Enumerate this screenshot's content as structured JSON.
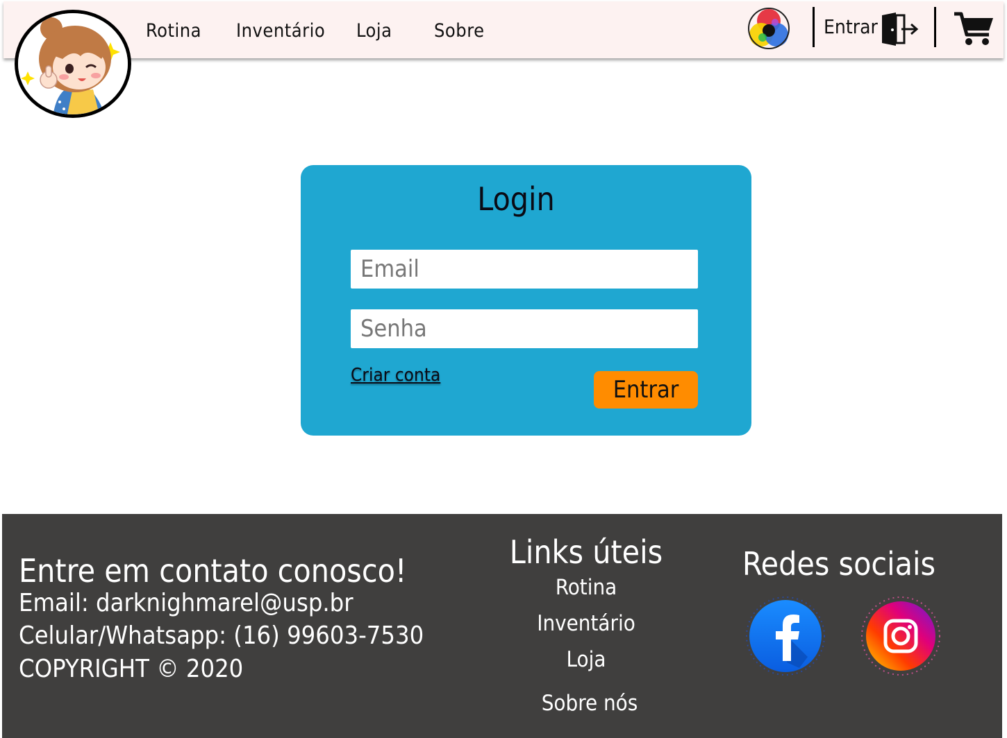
{
  "nav": {
    "links": [
      "Rotina",
      "Inventário",
      "Loja",
      "Sobre"
    ],
    "login_label": "Entrar"
  },
  "login": {
    "title": "Login",
    "email_placeholder": "Email",
    "password_placeholder": "Senha",
    "create_account": "Criar conta",
    "submit": "Entrar"
  },
  "footer": {
    "contact_title": "Entre em contato conosco!",
    "email_line": "Email: darknighmarel@usp.br",
    "phone_line": "Celular/Whatsapp: (16) 99603-7530",
    "copyright": "COPYRIGHT © 2020",
    "links_title": "Links úteis",
    "links": [
      "Rotina",
      "Inventário",
      "Loja",
      "Sobre nós"
    ],
    "social_title": "Redes sociais"
  },
  "colors": {
    "header_bg": "#fdf2f1",
    "card_bg": "#1fa7d1",
    "button_bg": "#ff8c00",
    "footer_bg": "#403f3e"
  },
  "icons": [
    "logo-avatar",
    "color-theme-icon",
    "door-exit-icon",
    "cart-icon",
    "facebook-icon",
    "instagram-icon"
  ]
}
